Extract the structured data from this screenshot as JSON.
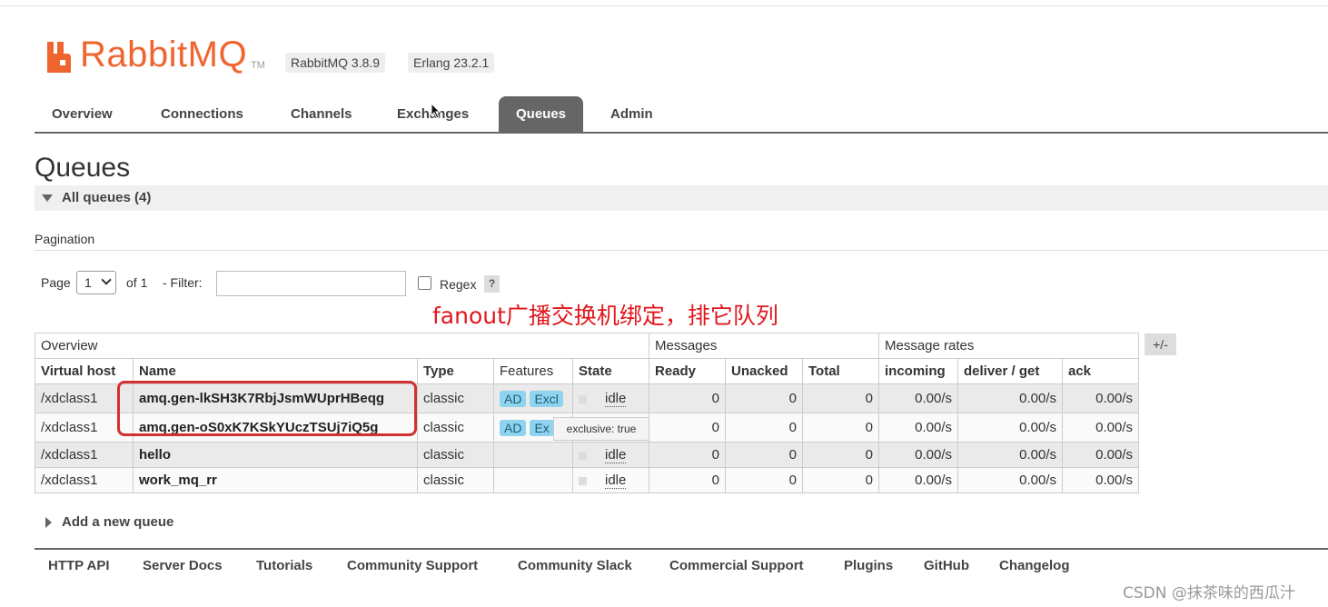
{
  "header": {
    "brand": "RabbitMQ",
    "trademark": "TM",
    "rabbitmq_version": "RabbitMQ 3.8.9",
    "erlang_version": "Erlang 23.2.1",
    "brand_color": "#f0652f"
  },
  "tabs": [
    {
      "label": "Overview"
    },
    {
      "label": "Connections"
    },
    {
      "label": "Channels"
    },
    {
      "label": "Exchanges"
    },
    {
      "label": "Queues",
      "active": true
    },
    {
      "label": "Admin"
    }
  ],
  "page": {
    "title": "Queues",
    "section": "All queues (4)",
    "pagination_title": "Pagination",
    "page_label": "Page",
    "page_value": "1",
    "of_label": "of 1",
    "filter_label": "- Filter:",
    "filter_value": "",
    "regex_label": "Regex",
    "regex_checked": false,
    "help_label": "?",
    "annotation": "fanout广播交换机绑定，排它队列"
  },
  "table": {
    "groups": {
      "overview": "Overview",
      "messages": "Messages",
      "rates": "Message rates"
    },
    "plus_minus": "+/-",
    "columns": [
      "Virtual host",
      "Name",
      "Type",
      "Features",
      "State",
      "Ready",
      "Unacked",
      "Total",
      "incoming",
      "deliver / get",
      "ack"
    ],
    "rows": [
      {
        "vhost": "/xdclass1",
        "name": "amq.gen-lkSH3K7RbjJsmWUprHBeqg",
        "type": "classic",
        "f1": "AD",
        "f2": "Excl",
        "state": "idle",
        "ready": "0",
        "unacked": "0",
        "total": "0",
        "incoming": "0.00/s",
        "deliver": "0.00/s",
        "ack": "0.00/s"
      },
      {
        "vhost": "/xdclass1",
        "name": "amq.gen-oS0xK7KSkYUczTSUj7iQ5g",
        "type": "classic",
        "f1": "AD",
        "f2": "Ex",
        "state": "",
        "ready": "0",
        "unacked": "0",
        "total": "0",
        "incoming": "0.00/s",
        "deliver": "0.00/s",
        "ack": "0.00/s"
      },
      {
        "vhost": "/xdclass1",
        "name": "hello",
        "type": "classic",
        "f1": "",
        "f2": "",
        "state": "idle",
        "ready": "0",
        "unacked": "0",
        "total": "0",
        "incoming": "0.00/s",
        "deliver": "0.00/s",
        "ack": "0.00/s"
      },
      {
        "vhost": "/xdclass1",
        "name": "work_mq_rr",
        "type": "classic",
        "f1": "",
        "f2": "",
        "state": "idle",
        "ready": "0",
        "unacked": "0",
        "total": "0",
        "incoming": "0.00/s",
        "deliver": "0.00/s",
        "ack": "0.00/s"
      }
    ],
    "tooltip": "exclusive: true"
  },
  "add_queue": "Add a new queue",
  "footer": [
    "HTTP API",
    "Server Docs",
    "Tutorials",
    "Community Support",
    "Community Slack",
    "Commercial Support",
    "Plugins",
    "GitHub",
    "Changelog"
  ],
  "watermark": "CSDN @抹茶味的西瓜汁"
}
